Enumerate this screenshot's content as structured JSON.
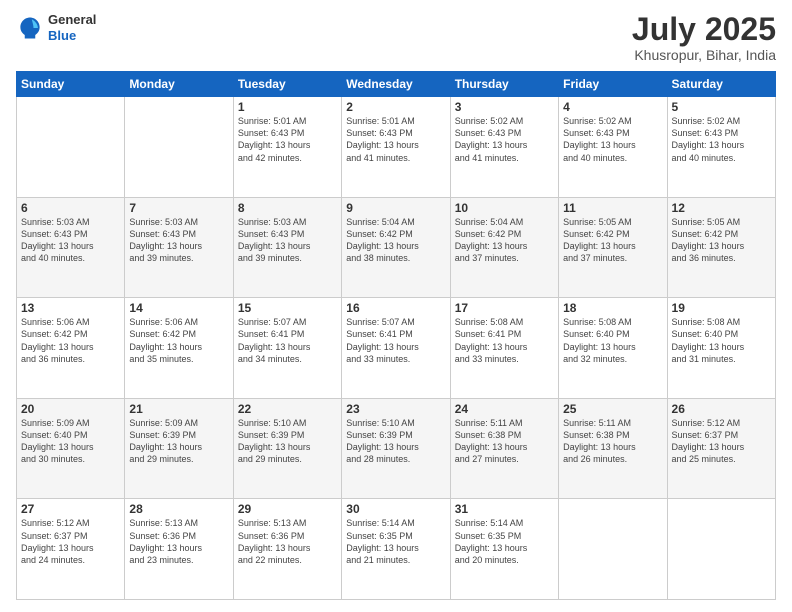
{
  "header": {
    "logo": {
      "general": "General",
      "blue": "Blue"
    },
    "title": "July 2025",
    "subtitle": "Khusropur, Bihar, India"
  },
  "calendar": {
    "weekdays": [
      "Sunday",
      "Monday",
      "Tuesday",
      "Wednesday",
      "Thursday",
      "Friday",
      "Saturday"
    ],
    "weeks": [
      [
        {
          "day": "",
          "info": ""
        },
        {
          "day": "",
          "info": ""
        },
        {
          "day": "1",
          "info": "Sunrise: 5:01 AM\nSunset: 6:43 PM\nDaylight: 13 hours\nand 42 minutes."
        },
        {
          "day": "2",
          "info": "Sunrise: 5:01 AM\nSunset: 6:43 PM\nDaylight: 13 hours\nand 41 minutes."
        },
        {
          "day": "3",
          "info": "Sunrise: 5:02 AM\nSunset: 6:43 PM\nDaylight: 13 hours\nand 41 minutes."
        },
        {
          "day": "4",
          "info": "Sunrise: 5:02 AM\nSunset: 6:43 PM\nDaylight: 13 hours\nand 40 minutes."
        },
        {
          "day": "5",
          "info": "Sunrise: 5:02 AM\nSunset: 6:43 PM\nDaylight: 13 hours\nand 40 minutes."
        }
      ],
      [
        {
          "day": "6",
          "info": "Sunrise: 5:03 AM\nSunset: 6:43 PM\nDaylight: 13 hours\nand 40 minutes."
        },
        {
          "day": "7",
          "info": "Sunrise: 5:03 AM\nSunset: 6:43 PM\nDaylight: 13 hours\nand 39 minutes."
        },
        {
          "day": "8",
          "info": "Sunrise: 5:03 AM\nSunset: 6:43 PM\nDaylight: 13 hours\nand 39 minutes."
        },
        {
          "day": "9",
          "info": "Sunrise: 5:04 AM\nSunset: 6:42 PM\nDaylight: 13 hours\nand 38 minutes."
        },
        {
          "day": "10",
          "info": "Sunrise: 5:04 AM\nSunset: 6:42 PM\nDaylight: 13 hours\nand 37 minutes."
        },
        {
          "day": "11",
          "info": "Sunrise: 5:05 AM\nSunset: 6:42 PM\nDaylight: 13 hours\nand 37 minutes."
        },
        {
          "day": "12",
          "info": "Sunrise: 5:05 AM\nSunset: 6:42 PM\nDaylight: 13 hours\nand 36 minutes."
        }
      ],
      [
        {
          "day": "13",
          "info": "Sunrise: 5:06 AM\nSunset: 6:42 PM\nDaylight: 13 hours\nand 36 minutes."
        },
        {
          "day": "14",
          "info": "Sunrise: 5:06 AM\nSunset: 6:42 PM\nDaylight: 13 hours\nand 35 minutes."
        },
        {
          "day": "15",
          "info": "Sunrise: 5:07 AM\nSunset: 6:41 PM\nDaylight: 13 hours\nand 34 minutes."
        },
        {
          "day": "16",
          "info": "Sunrise: 5:07 AM\nSunset: 6:41 PM\nDaylight: 13 hours\nand 33 minutes."
        },
        {
          "day": "17",
          "info": "Sunrise: 5:08 AM\nSunset: 6:41 PM\nDaylight: 13 hours\nand 33 minutes."
        },
        {
          "day": "18",
          "info": "Sunrise: 5:08 AM\nSunset: 6:40 PM\nDaylight: 13 hours\nand 32 minutes."
        },
        {
          "day": "19",
          "info": "Sunrise: 5:08 AM\nSunset: 6:40 PM\nDaylight: 13 hours\nand 31 minutes."
        }
      ],
      [
        {
          "day": "20",
          "info": "Sunrise: 5:09 AM\nSunset: 6:40 PM\nDaylight: 13 hours\nand 30 minutes."
        },
        {
          "day": "21",
          "info": "Sunrise: 5:09 AM\nSunset: 6:39 PM\nDaylight: 13 hours\nand 29 minutes."
        },
        {
          "day": "22",
          "info": "Sunrise: 5:10 AM\nSunset: 6:39 PM\nDaylight: 13 hours\nand 29 minutes."
        },
        {
          "day": "23",
          "info": "Sunrise: 5:10 AM\nSunset: 6:39 PM\nDaylight: 13 hours\nand 28 minutes."
        },
        {
          "day": "24",
          "info": "Sunrise: 5:11 AM\nSunset: 6:38 PM\nDaylight: 13 hours\nand 27 minutes."
        },
        {
          "day": "25",
          "info": "Sunrise: 5:11 AM\nSunset: 6:38 PM\nDaylight: 13 hours\nand 26 minutes."
        },
        {
          "day": "26",
          "info": "Sunrise: 5:12 AM\nSunset: 6:37 PM\nDaylight: 13 hours\nand 25 minutes."
        }
      ],
      [
        {
          "day": "27",
          "info": "Sunrise: 5:12 AM\nSunset: 6:37 PM\nDaylight: 13 hours\nand 24 minutes."
        },
        {
          "day": "28",
          "info": "Sunrise: 5:13 AM\nSunset: 6:36 PM\nDaylight: 13 hours\nand 23 minutes."
        },
        {
          "day": "29",
          "info": "Sunrise: 5:13 AM\nSunset: 6:36 PM\nDaylight: 13 hours\nand 22 minutes."
        },
        {
          "day": "30",
          "info": "Sunrise: 5:14 AM\nSunset: 6:35 PM\nDaylight: 13 hours\nand 21 minutes."
        },
        {
          "day": "31",
          "info": "Sunrise: 5:14 AM\nSunset: 6:35 PM\nDaylight: 13 hours\nand 20 minutes."
        },
        {
          "day": "",
          "info": ""
        },
        {
          "day": "",
          "info": ""
        }
      ]
    ]
  }
}
